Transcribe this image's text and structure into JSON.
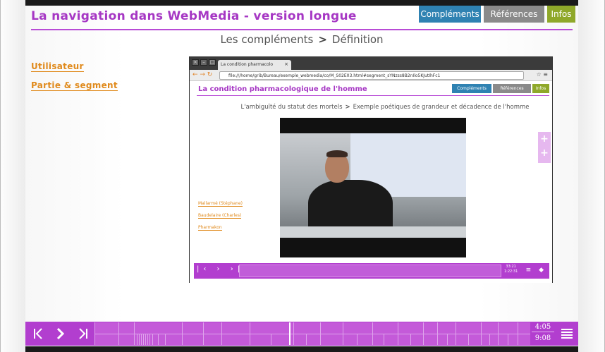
{
  "header": {
    "title": "La navigation dans WebMedia - version longue",
    "tabs": [
      "Compléments",
      "Références",
      "Infos"
    ]
  },
  "breadcrumb": {
    "parent": "Les compléments",
    "separator": ">",
    "current": "Définition"
  },
  "sidebar": {
    "links": [
      "Utilisateur",
      "Partie & segment"
    ]
  },
  "screenshot": {
    "browser_tab": "La condition pharmacolo",
    "url": "file:///home/grib/Bureau/exemple_webmedia/co/M_S02E03.html#segment_sYNzss8B2nIlo5KJutIhFc1",
    "title": "La condition pharmacologique de l'homme",
    "tabs": [
      "Compléments",
      "Références",
      "Infos"
    ],
    "breadcrumb_parent": "L'ambiguïté du statut des mortels",
    "breadcrumb_sep": ">",
    "breadcrumb_current": "Exemple poétiques de grandeur et décadence de l'homme",
    "side_links": [
      "Mallarmé (Stéphane)",
      "Baudelaire (Charles)",
      "Pharmakon"
    ],
    "time_current": "33:21",
    "time_total": "1:22:31"
  },
  "player": {
    "time_current": "4:05",
    "time_total": "9:08",
    "progress": 0.447
  },
  "icons": {
    "first": "skip-start-icon",
    "play": "play-icon",
    "last": "skip-end-icon",
    "menu": "menu-icon"
  }
}
